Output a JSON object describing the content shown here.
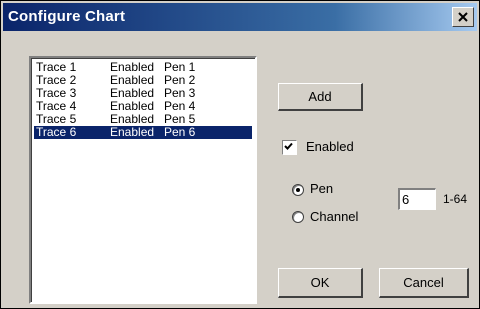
{
  "window": {
    "title": "Configure Chart"
  },
  "trace_list": {
    "rows": [
      {
        "trace": "Trace 1",
        "status": "Enabled",
        "pen": "Pen 1",
        "selected": false
      },
      {
        "trace": "Trace 2",
        "status": "Enabled",
        "pen": "Pen 2",
        "selected": false
      },
      {
        "trace": "Trace 3",
        "status": "Enabled",
        "pen": "Pen 3",
        "selected": false
      },
      {
        "trace": "Trace 4",
        "status": "Enabled",
        "pen": "Pen 4",
        "selected": false
      },
      {
        "trace": "Trace 5",
        "status": "Enabled",
        "pen": "Pen 5",
        "selected": false
      },
      {
        "trace": "Trace 6",
        "status": "Enabled",
        "pen": "Pen 6",
        "selected": true
      }
    ]
  },
  "controls": {
    "add_label": "Add",
    "enabled_label": "Enabled",
    "enabled_checked": true,
    "pen_label": "Pen",
    "channel_label": "Channel",
    "mode_selected": "Pen",
    "number_value": "6",
    "range_label": "1-64",
    "ok_label": "OK",
    "cancel_label": "Cancel"
  },
  "colors": {
    "title_bar": "#0a246a",
    "selection": "#0a246a",
    "face": "#d4d0c8"
  },
  "icons": {
    "close": "close-icon"
  }
}
